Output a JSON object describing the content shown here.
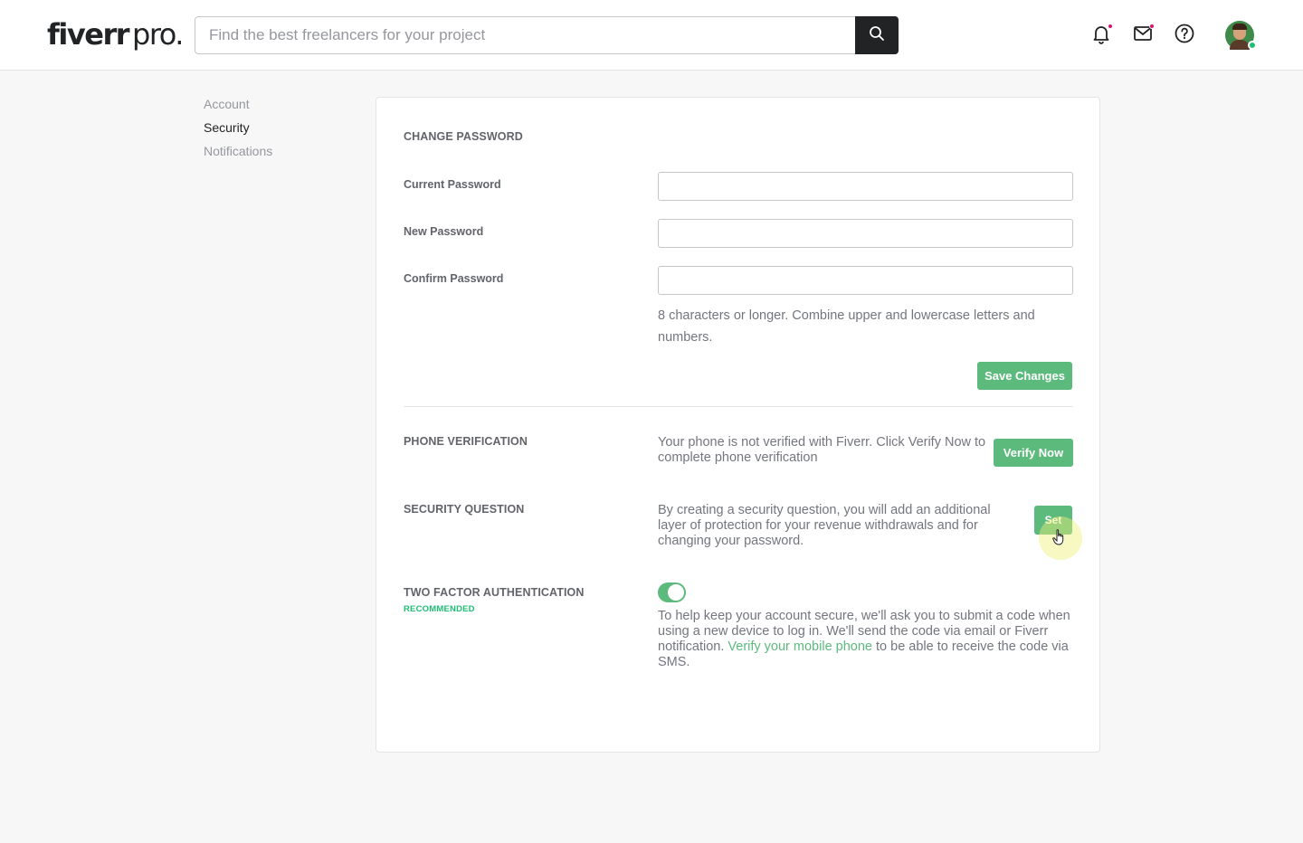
{
  "header": {
    "logo_main": "fiverr",
    "logo_pro": "pro",
    "logo_dot": ".",
    "search_placeholder": "Find the best freelancers for your project",
    "search_value": "",
    "icons": [
      "search-icon",
      "bell-icon",
      "envelope-icon",
      "help-icon"
    ]
  },
  "sidebar": {
    "items": [
      {
        "label": "Account",
        "active": false
      },
      {
        "label": "Security",
        "active": true
      },
      {
        "label": "Notifications",
        "active": false
      }
    ]
  },
  "change_password": {
    "title": "CHANGE PASSWORD",
    "current_label": "Current Password",
    "new_label": "New Password",
    "confirm_label": "Confirm Password",
    "current_value": "",
    "new_value": "",
    "confirm_value": "",
    "hint": "8 characters or longer. Combine upper and lowercase letters and numbers.",
    "save_label": "Save Changes"
  },
  "phone_verification": {
    "title": "PHONE VERIFICATION",
    "text": "Your phone is not verified with Fiverr. Click Verify Now to complete phone verification",
    "button_label": "Verify Now"
  },
  "security_question": {
    "title": "SECURITY QUESTION",
    "text": "By creating a security question, you will add an additional layer of protection for your revenue withdrawals and for changing your password.",
    "button_label": "Set"
  },
  "two_factor": {
    "title": "TWO FACTOR AUTHENTICATION",
    "badge": "RECOMMENDED",
    "enabled": true,
    "text_before": "To help keep your account secure, we'll ask you to submit a code when using a new device to log in. We'll send the code via email or Fiverr notification. ",
    "link": "Verify your mobile phone",
    "text_after": " to be able to receive the code via SMS."
  },
  "colors": {
    "accent_green": "#5cba7d",
    "brand_green": "#1dbf73",
    "notification_dot": "#e0116f",
    "dark": "#222325"
  }
}
